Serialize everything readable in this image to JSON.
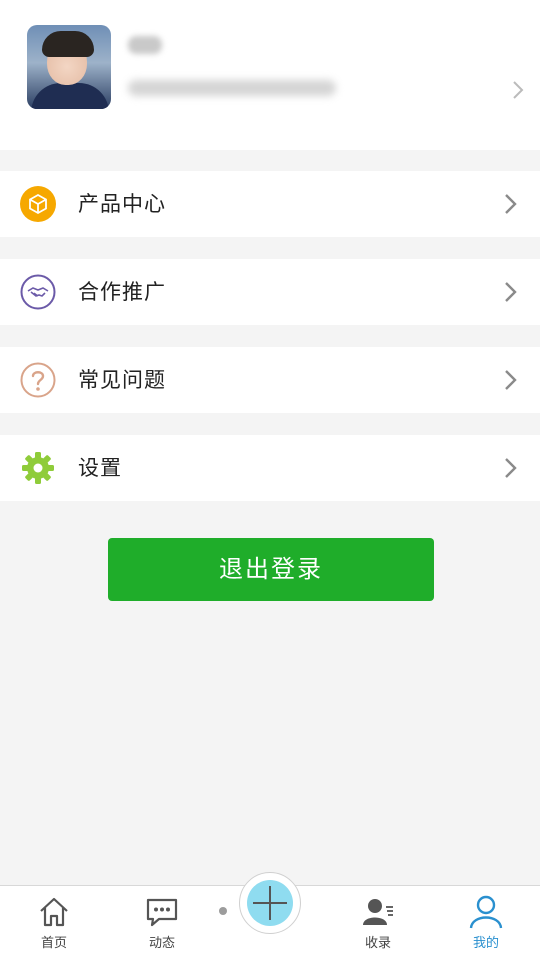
{
  "profile": {
    "avatar_alt": "avatar",
    "arrow": "›"
  },
  "menu": [
    {
      "label": "产品中心",
      "icon": "cube-icon",
      "color": "#f6a800"
    },
    {
      "label": "合作推广",
      "icon": "handshake-icon",
      "color": "#6b5aa8"
    },
    {
      "label": "常见问题",
      "icon": "question-icon",
      "color": "#d9a48a"
    },
    {
      "label": "设置",
      "icon": "gear-icon",
      "color": "#8fcc3a"
    }
  ],
  "logout": {
    "label": "退出登录",
    "color": "#1fad2a"
  },
  "tabbar": {
    "tabs": [
      {
        "label": "首页",
        "icon": "home-icon"
      },
      {
        "label": "动态",
        "icon": "chat-icon"
      },
      {
        "label": "收录",
        "icon": "contacts-icon"
      },
      {
        "label": "我的",
        "icon": "user-icon",
        "active": true
      }
    ],
    "active_color": "#2a90cf"
  }
}
